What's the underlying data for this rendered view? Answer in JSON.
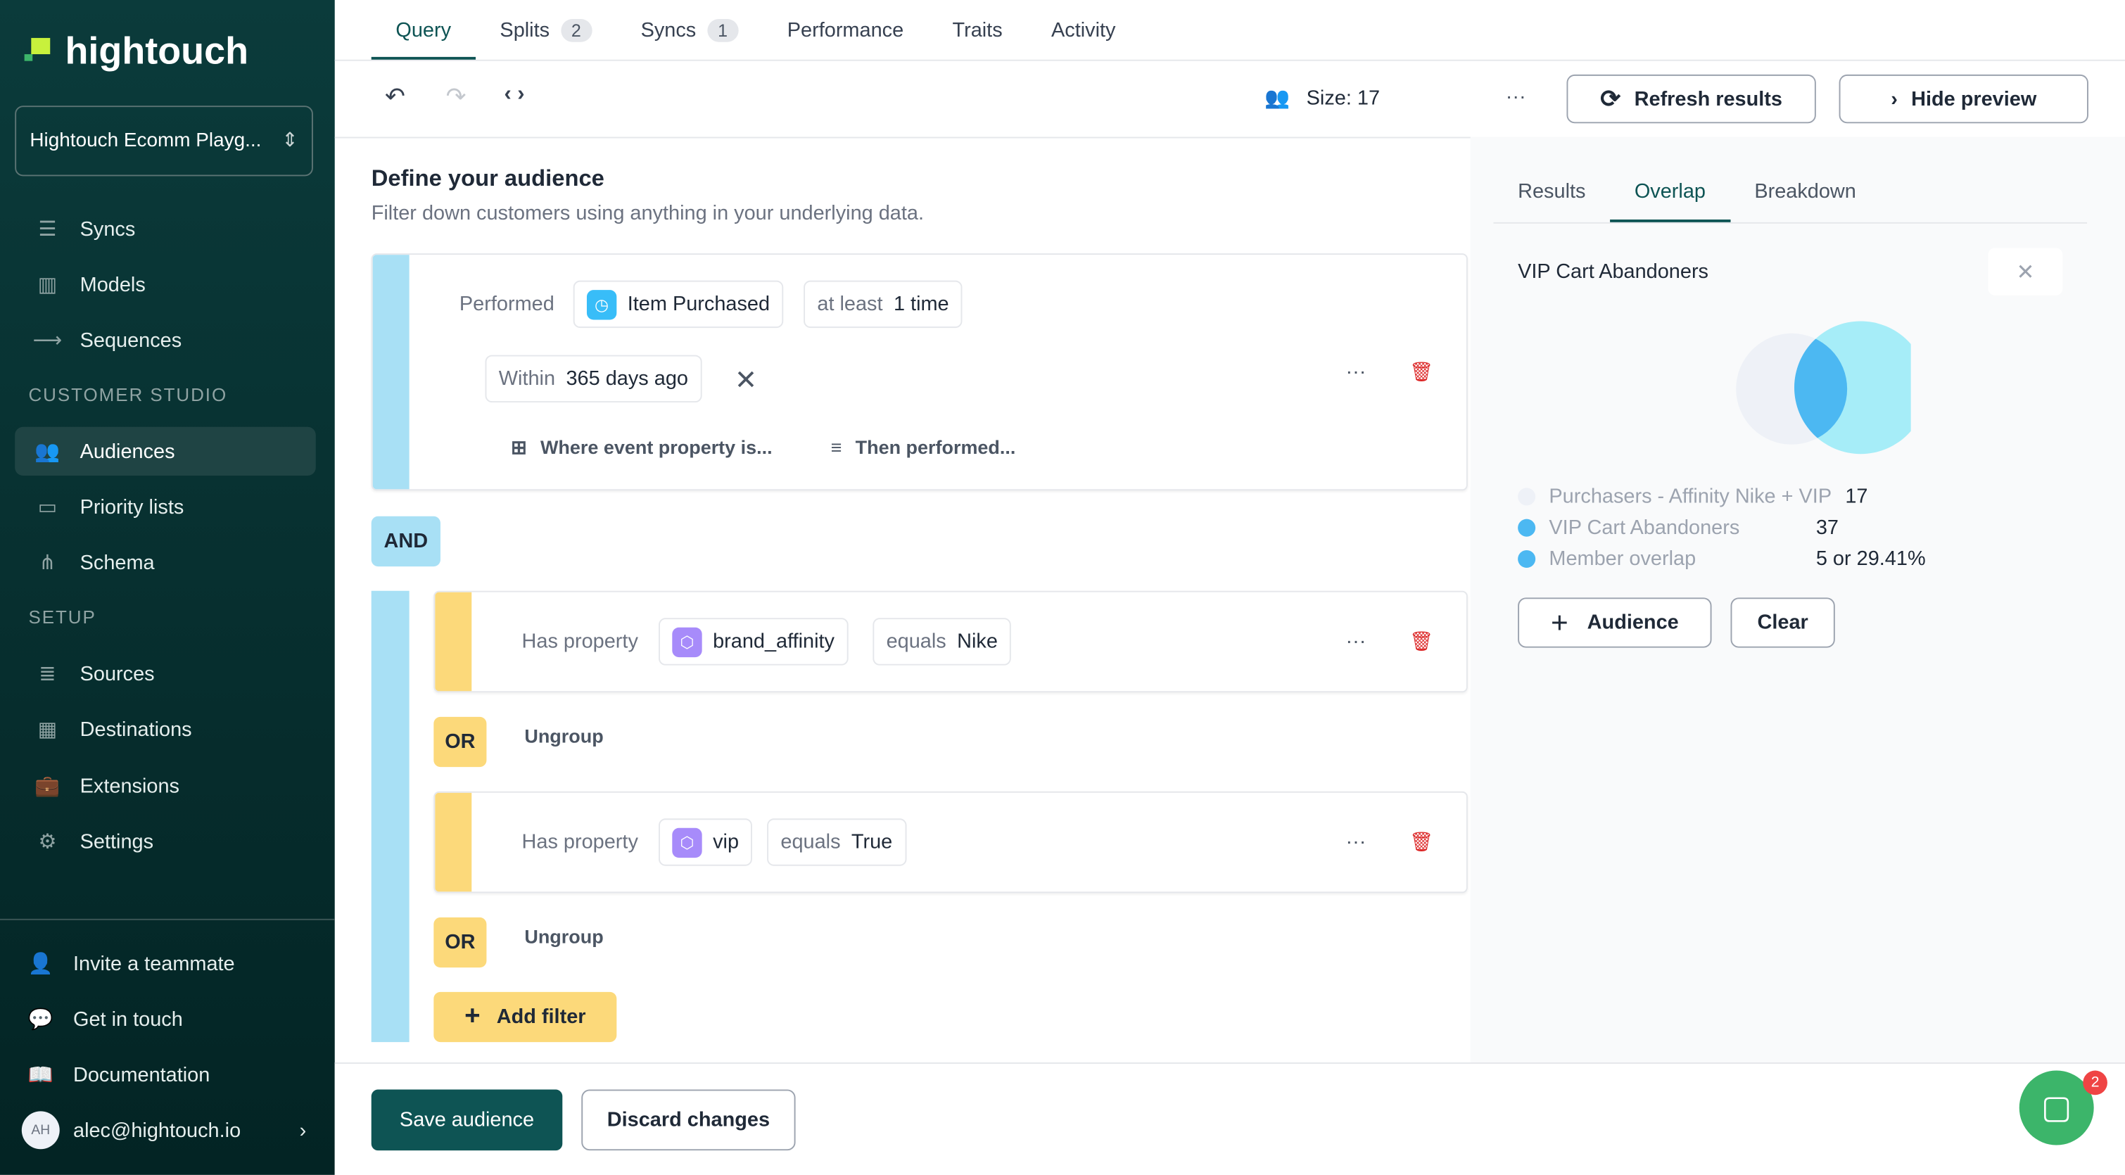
{
  "brand": {
    "name": "hightouch",
    "workspace": "Hightouch Ecomm Playg..."
  },
  "sidebar": {
    "items": [
      {
        "label": "Syncs",
        "icon": "syncs-icon"
      },
      {
        "label": "Models",
        "icon": "models-icon"
      },
      {
        "label": "Sequences",
        "icon": "sequences-icon"
      }
    ],
    "customer_studio_header": "CUSTOMER STUDIO",
    "studio_items": [
      {
        "label": "Audiences",
        "icon": "audiences-icon",
        "active": true
      },
      {
        "label": "Priority lists",
        "icon": "priority-lists-icon"
      },
      {
        "label": "Schema",
        "icon": "schema-icon"
      }
    ],
    "setup_header": "SETUP",
    "setup_items": [
      {
        "label": "Sources",
        "icon": "sources-icon"
      },
      {
        "label": "Destinations",
        "icon": "destinations-icon"
      },
      {
        "label": "Extensions",
        "icon": "extensions-icon"
      },
      {
        "label": "Settings",
        "icon": "gear-icon"
      }
    ],
    "bottom": [
      {
        "label": "Invite a teammate"
      },
      {
        "label": "Get in touch"
      },
      {
        "label": "Documentation"
      }
    ],
    "user": {
      "initials": "AH",
      "email": "alec@hightouch.io"
    }
  },
  "tabs": [
    {
      "label": "Query",
      "active": true
    },
    {
      "label": "Splits",
      "count": "2"
    },
    {
      "label": "Syncs",
      "count": "1"
    },
    {
      "label": "Performance"
    },
    {
      "label": "Traits"
    },
    {
      "label": "Activity"
    }
  ],
  "toolbar": {
    "size_label": "Size: 17",
    "more": "···",
    "refresh": "Refresh results",
    "hide_preview": "Hide preview"
  },
  "builder": {
    "title": "Define your audience",
    "subtitle": "Filter down customers using anything in your underlying data.",
    "event": {
      "performed": "Performed",
      "event_name": "Item Purchased",
      "freq_prefix": "at least",
      "freq_value": "1 time",
      "within_prefix": "Within",
      "within_value": "365 days ago",
      "where": "Where event property is...",
      "then": "Then performed..."
    },
    "and_label": "AND",
    "conditions": [
      {
        "has": "Has property",
        "property": "brand_affinity",
        "op": "equals",
        "value": "Nike"
      },
      {
        "has": "Has property",
        "property": "vip",
        "op": "equals",
        "value": "True"
      }
    ],
    "or_label": "OR",
    "ungroup": "Ungroup",
    "add_filter": "Add filter",
    "more": "···"
  },
  "preview": {
    "tabs": [
      {
        "label": "Results"
      },
      {
        "label": "Overlap",
        "active": true
      },
      {
        "label": "Breakdown"
      }
    ],
    "compare_title": "VIP Cart Abandoners",
    "legend": [
      {
        "label": "Purchasers - Affinity Nike + VIP",
        "value": "17",
        "color": "#eef1f7"
      },
      {
        "label": "VIP Cart Abandoners",
        "value": "37",
        "color": "#4cb8f2"
      },
      {
        "label": "Member overlap",
        "value": "5 or 29.41%",
        "color": "#4cb8f2"
      }
    ],
    "add_audience": "Audience",
    "clear": "Clear"
  },
  "footer": {
    "save": "Save audience",
    "discard": "Discard changes",
    "chat_badge": "2"
  },
  "colors": {
    "sidebar": "#0b3b3b",
    "accent": "#0e5454",
    "event_bar": "#a8e0f5",
    "condition_bar": "#fcd97a",
    "venn_left": "#eef1f7",
    "venn_right": "#a6edf8",
    "venn_overlap": "#4cb8f2"
  }
}
